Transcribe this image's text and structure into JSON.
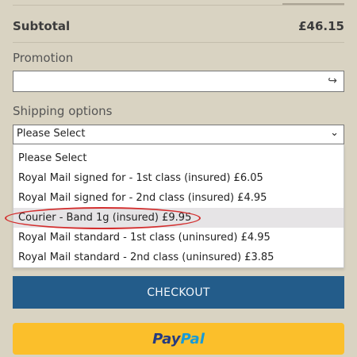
{
  "summary": {
    "subtotal_label": "Subtotal",
    "subtotal_value": "£46.15"
  },
  "promotion": {
    "label": "Promotion",
    "value": "",
    "placeholder": "",
    "apply_icon": "enter-arrow-icon"
  },
  "shipping": {
    "label": "Shipping options",
    "selected": "Please Select",
    "options": [
      "Please Select",
      "Royal Mail signed for - 1st class (insured) £6.05",
      "Royal Mail signed for - 2nd class (insured) £4.95",
      "Courier - Band 1g (insured) £9.95",
      "Royal Mail standard - 1st class (uninsured) £4.95",
      "Royal Mail standard - 2nd class (uninsured) £3.85"
    ],
    "highlighted_index": 3
  },
  "actions": {
    "checkout_label": "CHECKOUT",
    "paypal_part1": "Pay",
    "paypal_part2": "Pal"
  },
  "colors": {
    "page_background": "#d9d3c2",
    "checkout_button": "#235c8a",
    "paypal_button": "#fbbf2b",
    "annotation_circle": "#d32f2f"
  }
}
